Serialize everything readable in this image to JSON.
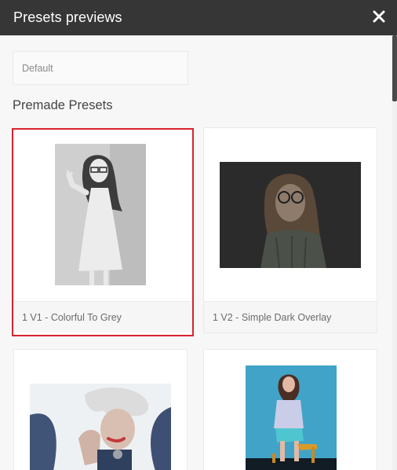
{
  "dialog": {
    "title": "Presets previews",
    "close_icon": "close-icon"
  },
  "search": {
    "placeholder": "Default"
  },
  "section": {
    "title": "Premade Presets"
  },
  "presets": [
    {
      "label": "1 V1 - Colorful To Grey",
      "selected": true
    },
    {
      "label": "1 V2 - Simple Dark Overlay",
      "selected": false
    },
    {
      "label": "",
      "selected": false
    },
    {
      "label": "",
      "selected": false
    }
  ],
  "colors": {
    "titlebar": "#363636",
    "selected_border": "#d9232d",
    "background": "#f7f7f7"
  }
}
